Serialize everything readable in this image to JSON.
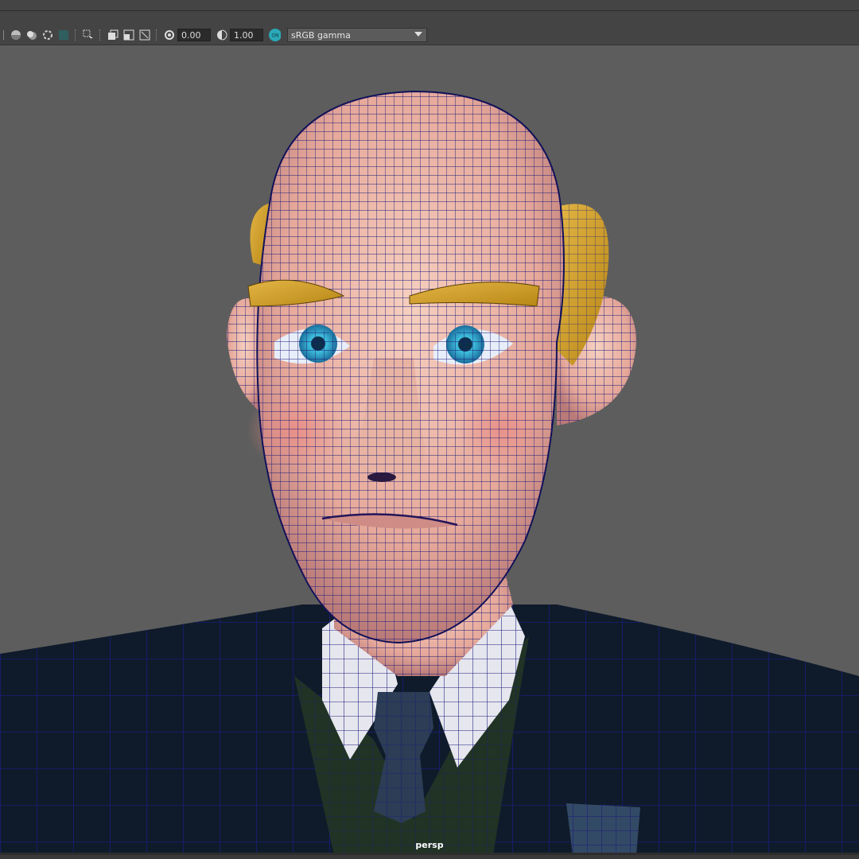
{
  "toolbar": {
    "exposure_value": "0.00",
    "gamma_value": "1.00",
    "color_mgmt_badge": "ON",
    "colorspace_label": "sRGB gamma"
  },
  "viewport": {
    "camera_label": "persp",
    "background_color": "#5d5d5d",
    "wireframe_color": "#1b1b7a"
  },
  "icons": [
    "shaded-sphere-icon",
    "smooth-sphere-icon",
    "isolate-icon",
    "texture-icon",
    "select-camera-icon",
    "display-layer-icon",
    "copy-icon",
    "resolution-gate-icon",
    "exposure-icon",
    "gamma-icon",
    "color-management-icon",
    "dropdown-arrow-icon"
  ]
}
